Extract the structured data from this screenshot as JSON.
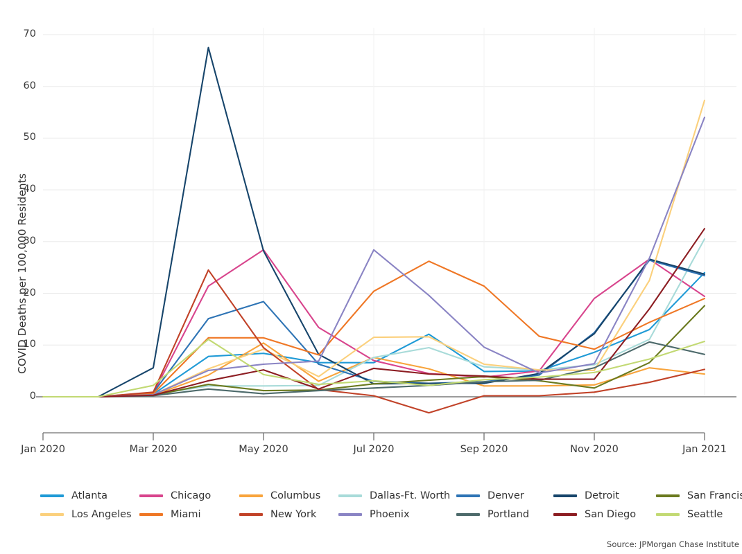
{
  "chart_data": {
    "type": "line",
    "title": "",
    "subtitle": "",
    "xlabel": "",
    "ylabel": "COVID Deaths per 100,000 Residents",
    "source": "Source: JPMorgan Chase Institute",
    "grid": true,
    "legend_position": "bottom",
    "x": [
      "Jan 2020",
      "Feb 2020",
      "Mar 2020",
      "Apr 2020",
      "May 2020",
      "Jun 2020",
      "Jul 2020",
      "Aug 2020",
      "Sep 2020",
      "Oct 2020",
      "Nov 2020",
      "Dec 2020",
      "Jan 2021"
    ],
    "x_tick_labels": [
      "Jan 2020",
      "Mar 2020",
      "May 2020",
      "Jul 2020",
      "Sep 2020",
      "Nov 2020",
      "Jan 2021"
    ],
    "y_tick_labels": [
      "0",
      "10",
      "20",
      "30",
      "40",
      "50",
      "60",
      "70"
    ],
    "y_ticks": [
      0,
      10,
      20,
      30,
      40,
      50,
      60,
      70
    ],
    "ylim": [
      -5,
      72
    ],
    "xlim": [
      "Jan 2020",
      "Jan 2021"
    ],
    "series": [
      {
        "name": "Atlanta",
        "color": "#1f9ad6",
        "values": [
          0,
          0,
          0.5,
          7.8,
          8.4,
          6.6,
          6.6,
          12.1,
          4.9,
          5.0,
          8.6,
          13.0,
          24.0
        ]
      },
      {
        "name": "Chicago",
        "color": "#d8458d",
        "values": [
          0,
          0,
          0.7,
          21.4,
          28.4,
          13.4,
          7.0,
          4.5,
          3.8,
          5.0,
          19.0,
          26.6,
          19.4
        ]
      },
      {
        "name": "Columbus",
        "color": "#f8a43c",
        "values": [
          0,
          0,
          0.3,
          4.2,
          10.4,
          3.0,
          7.6,
          5.4,
          2.1,
          2.1,
          2.3,
          5.6,
          4.4
        ]
      },
      {
        "name": "Dallas-Ft. Worth",
        "color": "#a8dbd9",
        "values": [
          0,
          0,
          0.4,
          2.1,
          2.1,
          2.2,
          7.6,
          9.5,
          5.8,
          5.2,
          6.2,
          11.1,
          30.5
        ]
      },
      {
        "name": "Denver",
        "color": "#2e74b5",
        "values": [
          0,
          0,
          0.8,
          15.1,
          18.4,
          6.3,
          3.0,
          2.6,
          2.9,
          4.2,
          12.4,
          26.4,
          23.4
        ]
      },
      {
        "name": "Detroit",
        "color": "#17456b",
        "values": [
          0,
          0,
          5.6,
          67.5,
          28.2,
          8.2,
          2.5,
          2.6,
          2.6,
          4.5,
          12.2,
          26.6,
          23.7
        ]
      },
      {
        "name": "San Francisco",
        "color": "#6b7a1f",
        "values": [
          0,
          0,
          0.3,
          2.4,
          1.2,
          1.3,
          2.5,
          3.2,
          3.9,
          3.1,
          1.7,
          6.6,
          17.6
        ]
      },
      {
        "name": "Los Angeles",
        "color": "#fbd07c",
        "values": [
          0,
          0,
          0.4,
          5.4,
          9.2,
          3.9,
          11.5,
          11.6,
          6.3,
          5.2,
          5.1,
          22.5,
          57.3
        ]
      },
      {
        "name": "Miami",
        "color": "#ef7725",
        "values": [
          0,
          0,
          0.6,
          11.4,
          11.4,
          8.1,
          20.4,
          26.2,
          21.4,
          11.7,
          9.2,
          14.4,
          19.0
        ]
      },
      {
        "name": "New York",
        "color": "#c14228",
        "values": [
          0,
          0,
          0.9,
          24.5,
          9.5,
          1.4,
          0.2,
          -3.1,
          0.2,
          0.2,
          0.9,
          2.8,
          5.3
        ]
      },
      {
        "name": "Phoenix",
        "color": "#8a84c4",
        "values": [
          0,
          0,
          0.4,
          5.1,
          6.3,
          6.9,
          28.4,
          19.6,
          9.6,
          4.6,
          6.4,
          26.8,
          54.0
        ]
      },
      {
        "name": "Portland",
        "color": "#4d6a6b",
        "values": [
          0,
          0,
          0.2,
          1.5,
          0.6,
          1.2,
          1.7,
          2.2,
          2.9,
          3.2,
          5.6,
          10.6,
          8.2
        ]
      },
      {
        "name": "San Diego",
        "color": "#8c1d22",
        "values": [
          0,
          0,
          0.3,
          3.1,
          5.2,
          1.5,
          5.5,
          4.4,
          4.0,
          3.4,
          3.4,
          17.0,
          32.5
        ]
      },
      {
        "name": "Seattle",
        "color": "#c2d973",
        "values": [
          0,
          0,
          2.2,
          11.1,
          4.3,
          2.4,
          3.1,
          2.2,
          3.3,
          3.8,
          4.7,
          7.3,
          10.7
        ]
      }
    ]
  },
  "legend": {
    "columns": [
      {
        "items": [
          {
            "label": "Atlanta",
            "color": "#1f9ad6"
          },
          {
            "label": "Los Angeles",
            "color": "#fbd07c"
          }
        ]
      },
      {
        "items": [
          {
            "label": "Chicago",
            "color": "#d8458d"
          },
          {
            "label": "Miami",
            "color": "#ef7725"
          }
        ]
      },
      {
        "items": [
          {
            "label": "Columbus",
            "color": "#f8a43c"
          },
          {
            "label": "New York",
            "color": "#c14228"
          }
        ]
      },
      {
        "items": [
          {
            "label": "Dallas-Ft. Worth",
            "color": "#a8dbd9"
          },
          {
            "label": "Phoenix",
            "color": "#8a84c4"
          }
        ]
      },
      {
        "items": [
          {
            "label": "Denver",
            "color": "#2e74b5"
          },
          {
            "label": "Portland",
            "color": "#4d6a6b"
          }
        ]
      },
      {
        "items": [
          {
            "label": "Detroit",
            "color": "#17456b"
          },
          {
            "label": "San Diego",
            "color": "#8c1d22"
          }
        ]
      },
      {
        "items": [
          {
            "label": "San Francisco",
            "color": "#6b7a1f"
          },
          {
            "label": "Seattle",
            "color": "#c2d973"
          }
        ]
      }
    ]
  },
  "style": {
    "grid_color": "#e8e8e8",
    "axis_color": "#6f6f6f",
    "zero_line_color": "#7a7a7a",
    "background": "#ffffff"
  }
}
